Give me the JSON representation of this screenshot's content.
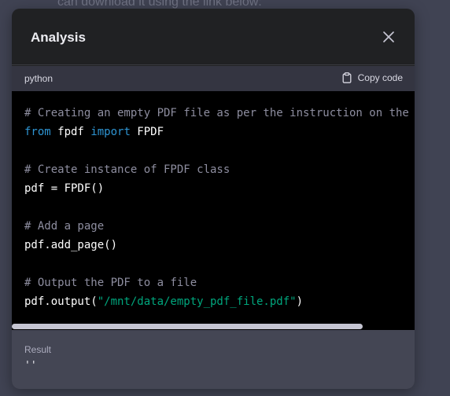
{
  "background": {
    "text": "can download it using the link below:"
  },
  "modal": {
    "title": "Analysis",
    "close_icon": "close-icon"
  },
  "code_block": {
    "language": "python",
    "copy_label": "Copy code",
    "copy_icon": "clipboard-icon",
    "lines": [
      [
        {
          "t": "# Creating an empty PDF file as per the instruction on the",
          "c": "comment"
        }
      ],
      [
        {
          "t": "from",
          "c": "kw"
        },
        {
          "t": " fpdf ",
          "c": "plain"
        },
        {
          "t": "import",
          "c": "kw"
        },
        {
          "t": " FPDF",
          "c": "plain"
        }
      ],
      [],
      [
        {
          "t": "# Create instance of FPDF class",
          "c": "comment"
        }
      ],
      [
        {
          "t": "pdf = FPDF()",
          "c": "plain"
        }
      ],
      [],
      [
        {
          "t": "# Add a page",
          "c": "comment"
        }
      ],
      [
        {
          "t": "pdf.add_page()",
          "c": "plain"
        }
      ],
      [],
      [
        {
          "t": "# Output the PDF to a file",
          "c": "comment"
        }
      ],
      [
        {
          "t": "pdf.output(",
          "c": "plain"
        },
        {
          "t": "\"/mnt/data/empty_pdf_file.pdf\"",
          "c": "str"
        },
        {
          "t": ")",
          "c": "plain"
        }
      ]
    ]
  },
  "result": {
    "label": "Result",
    "value": "''"
  },
  "colors": {
    "comment": "#8e8ea0",
    "keyword": "#2e95d3",
    "string": "#00a67d",
    "page_background": "#404353",
    "modal_background": "#202123"
  }
}
